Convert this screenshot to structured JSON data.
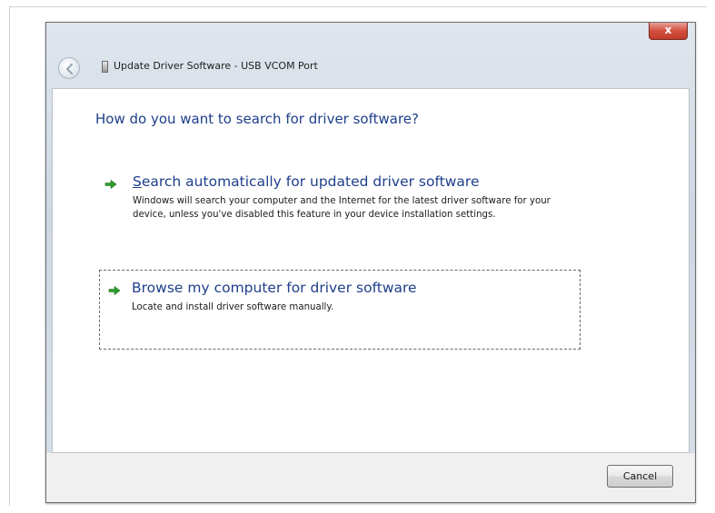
{
  "window": {
    "title": "Update Driver Software - USB VCOM Port",
    "close_label": "x"
  },
  "content": {
    "question": "How do you want to search for driver software?",
    "options": [
      {
        "title_first_letter": "S",
        "title_rest": "earch automatically for updated driver software",
        "description": "Windows will search your computer and the Internet for the latest driver software for your device, unless you've disabled this feature in your device installation settings."
      },
      {
        "title": "Browse my computer for driver software",
        "description": "Locate and install driver software manually."
      }
    ]
  },
  "footer": {
    "cancel_label": "Cancel"
  },
  "colors": {
    "question_text": "#1e3f8a",
    "arrow_green": "#2f9e2f",
    "close_red": "#c03a28"
  }
}
